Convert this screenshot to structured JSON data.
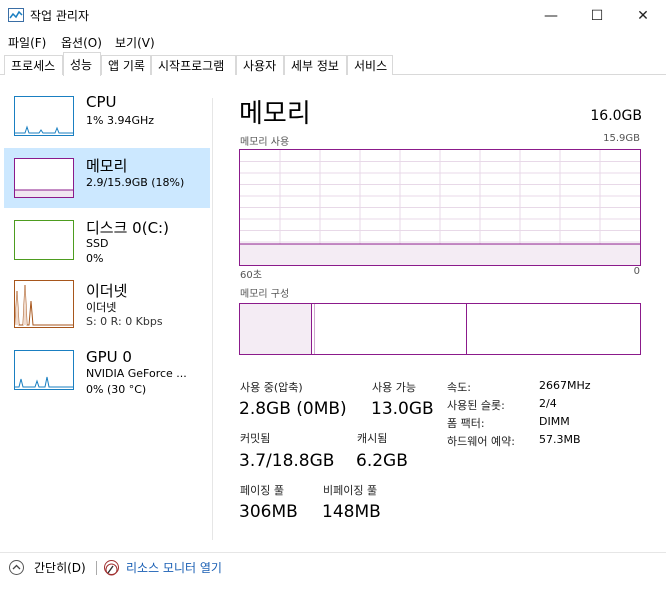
{
  "window": {
    "title": "작업 관리자",
    "minimize_glyph": "—",
    "maximize_glyph": "☐",
    "close_glyph": "✕"
  },
  "menu": [
    "파일(F)",
    "옵션(O)",
    "보기(V)"
  ],
  "tabs": [
    "프로세스",
    "성능",
    "앱 기록",
    "시작프로그램",
    "사용자",
    "세부 정보",
    "서비스"
  ],
  "active_tab": "성능",
  "sidebar": {
    "items": [
      {
        "name": "CPU",
        "line1": "1% 3.94GHz",
        "line2": "",
        "color": "#1a7fc1",
        "selected": false
      },
      {
        "name": "메모리",
        "line1": "2.9/15.9GB (18%)",
        "line2": "",
        "color": "#8b1a8b",
        "selected": true
      },
      {
        "name": "디스크 0(C:)",
        "line1": "SSD",
        "line2": "0%",
        "color": "#4d9c1f",
        "selected": false
      },
      {
        "name": "이더넷",
        "line1": "이더넷",
        "line2": "S: 0 R: 0 Kbps",
        "color": "#a7561c",
        "selected": false
      },
      {
        "name": "GPU 0",
        "line1": "NVIDIA GeForce ...",
        "line2": "0% (30 °C)",
        "color": "#1a7fc1",
        "selected": false
      }
    ]
  },
  "main": {
    "title": "메모리",
    "total": "16.0GB",
    "usage_graph_label": "메모리 사용",
    "usage_graph_max": "15.9GB",
    "x_axis_left": "60초",
    "x_axis_right": "0",
    "composition_label": "메모리 구성",
    "usage_fraction": 0.18,
    "accent_color": "#8b1a8b",
    "stats": {
      "in_use_label": "사용 중(압축)",
      "in_use_value": "2.8GB (0MB)",
      "available_label": "사용 가능",
      "available_value": "13.0GB",
      "committed_label": "커밋됨",
      "committed_value": "3.7/18.8GB",
      "cached_label": "캐시됨",
      "cached_value": "6.2GB",
      "paged_label": "페이징 풀",
      "paged_value": "306MB",
      "nonpaged_label": "비페이징 풀",
      "nonpaged_value": "148MB"
    },
    "specs": [
      {
        "label": "속도:",
        "value": "2667MHz"
      },
      {
        "label": "사용된 슬롯:",
        "value": "2/4"
      },
      {
        "label": "폼 팩터:",
        "value": "DIMM"
      },
      {
        "label": "하드웨어 예약:",
        "value": "57.3MB"
      }
    ]
  },
  "footer": {
    "collapse_label": "간단히(D)",
    "resmon_label": "리소스 모니터 열기"
  }
}
